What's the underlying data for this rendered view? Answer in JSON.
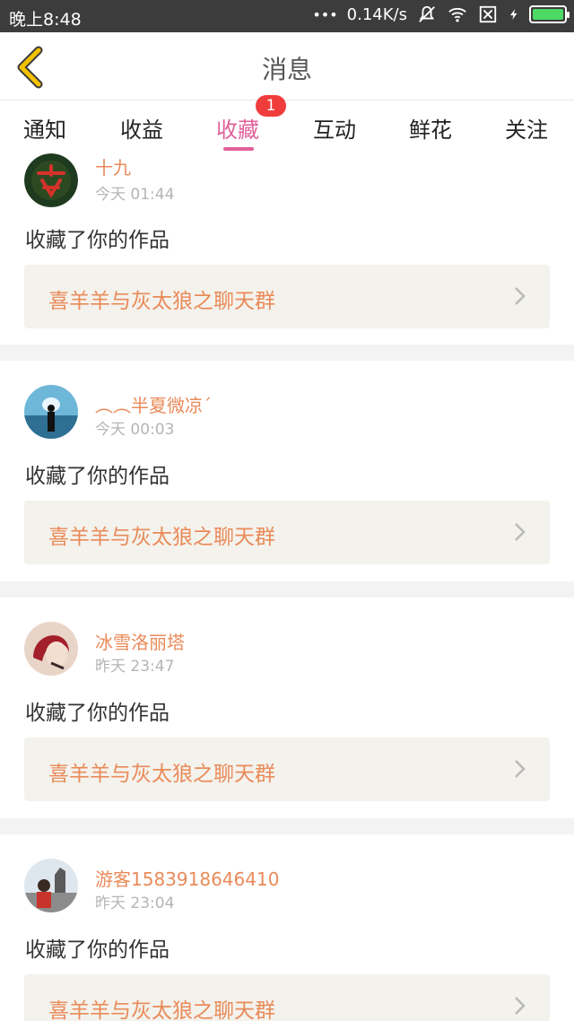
{
  "status_bar": {
    "time": "晚上8:48",
    "dots": "•••",
    "speed": "0.14K/s",
    "icons": [
      "mute-icon",
      "wifi-icon",
      "sim-off-icon",
      "charging-icon",
      "battery-icon"
    ],
    "battery_level": 1.0,
    "battery_color": "#4cd964"
  },
  "header": {
    "title": "消息",
    "back_icon": "back-chevron-icon",
    "back_color": "#f2c200"
  },
  "tabs": [
    {
      "label": "通知"
    },
    {
      "label": "收益"
    },
    {
      "label": "收藏",
      "active": true,
      "badge": "1"
    },
    {
      "label": "互动"
    },
    {
      "label": "鲜花"
    },
    {
      "label": "关注"
    }
  ],
  "accent_color": "#e0609a",
  "name_color": "#e98b5a",
  "feed": [
    {
      "user": "十九",
      "time": "今天 01:44",
      "action": "收藏了你的作品",
      "work": "喜羊羊与灰太狼之聊天群"
    },
    {
      "user": "︵︵半夏微凉ˊ",
      "time": "今天 00:03",
      "action": "收藏了你的作品",
      "work": "喜羊羊与灰太狼之聊天群"
    },
    {
      "user": "冰雪洛丽塔",
      "time": "昨天 23:47",
      "action": "收藏了你的作品",
      "work": "喜羊羊与灰太狼之聊天群"
    },
    {
      "user": "游客1583918646410",
      "time": "昨天 23:04",
      "action": "收藏了你的作品",
      "work": "喜羊羊与灰太狼之聊天群"
    }
  ]
}
